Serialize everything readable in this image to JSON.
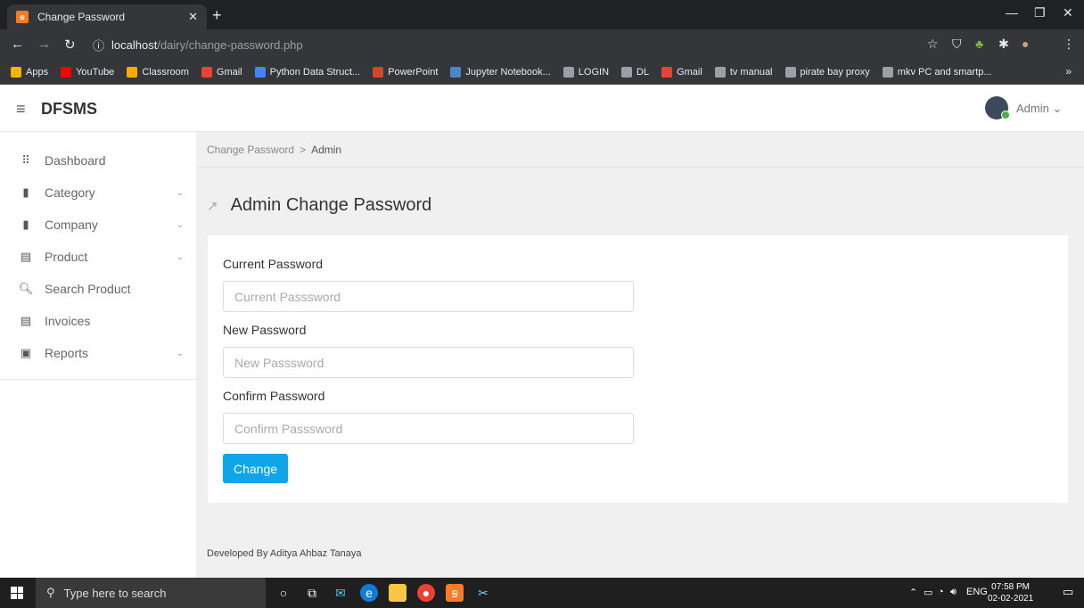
{
  "browser": {
    "tab_title": "Change Password",
    "tab_favicon": "xampp",
    "address": {
      "host": "localhost",
      "path": "/dairy/change-password.php"
    },
    "bookmarks": [
      {
        "label": "Apps",
        "color": "#f4b400"
      },
      {
        "label": "YouTube",
        "color": "#ff0000"
      },
      {
        "label": "Classroom",
        "color": "#f9ab00"
      },
      {
        "label": "Gmail",
        "color": "#ea4335"
      },
      {
        "label": "Python Data Struct...",
        "color": "#4285f4"
      },
      {
        "label": "PowerPoint",
        "color": "#d24726"
      },
      {
        "label": "Jupyter Notebook...",
        "color": "#4a86c8"
      },
      {
        "label": "LOGIN",
        "color": "#9aa0a6"
      },
      {
        "label": "DL",
        "color": "#9aa0a6"
      },
      {
        "label": "Gmail",
        "color": "#ea4335"
      },
      {
        "label": "tv manual",
        "color": "#9aa0a6"
      },
      {
        "label": "pirate bay proxy",
        "color": "#9aa0a6"
      },
      {
        "label": "mkv PC and smartp...",
        "color": "#9aa0a6"
      }
    ],
    "more": "»"
  },
  "header": {
    "brand": "DFSMS",
    "user": "Admin ⌄"
  },
  "sidebar": {
    "items": [
      {
        "label": "Dashboard",
        "icon": "grid-icon",
        "glyph": "⠿",
        "chevron": ""
      },
      {
        "label": "Category",
        "icon": "file-icon",
        "glyph": "▮",
        "chevron": "⌄"
      },
      {
        "label": "Company",
        "icon": "file-icon",
        "glyph": "▮",
        "chevron": "⌄"
      },
      {
        "label": "Product",
        "icon": "list-icon",
        "glyph": "▤",
        "chevron": "⌄"
      },
      {
        "label": "Search Product",
        "icon": "search-icon",
        "glyph": "🔍︎",
        "chevron": ""
      },
      {
        "label": "Invoices",
        "icon": "list-icon",
        "glyph": "▤",
        "chevron": ""
      },
      {
        "label": "Reports",
        "icon": "report-icon",
        "glyph": "▣",
        "chevron": "⌄"
      }
    ]
  },
  "breadcrumb": {
    "first": "Change Password",
    "sep": ">",
    "current": "Admin"
  },
  "page_title": "Admin Change Password",
  "form": {
    "current_label": "Current Password",
    "current_placeholder": "Current Passsword",
    "new_label": "New Password",
    "new_placeholder": "New Passsword",
    "confirm_label": "Confirm Password",
    "confirm_placeholder": "Confirm Passsword",
    "submit": "Change"
  },
  "footer": "Developed By Aditya Ahbaz Tanaya",
  "taskbar": {
    "search_placeholder": "Type here to search",
    "language": "ENG",
    "time": "07:58 PM",
    "date": "02-02-2021"
  }
}
